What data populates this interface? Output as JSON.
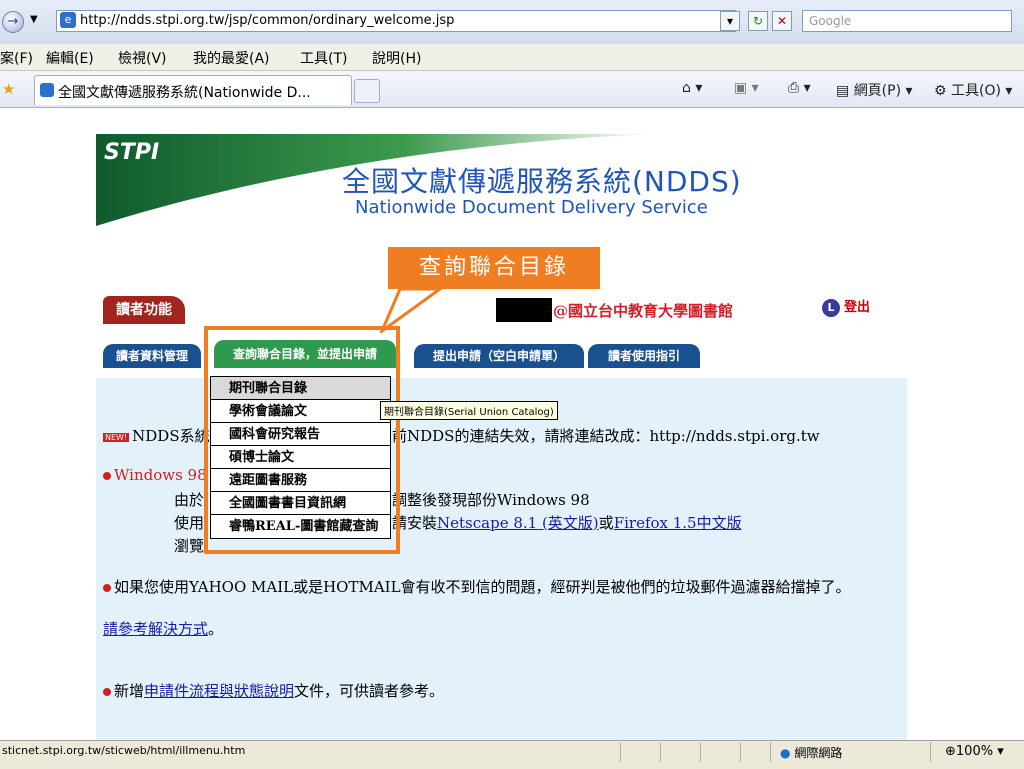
{
  "browser": {
    "url": "http://ndds.stpi.org.tw/jsp/common/ordinary_welcome.jsp",
    "search_placeholder": "Google",
    "menu": [
      "案(F)",
      "編輯(E)",
      "檢視(V)",
      "我的最愛(A)",
      "工具(T)",
      "說明(H)"
    ],
    "tab_title": "全國文獻傳遞服務系統(Nationwide D...",
    "toolbar_page": "網頁(P)",
    "toolbar_tools": "工具(O)"
  },
  "header": {
    "logo": "STPI",
    "title": "全國文獻傳遞服務系統(NDDS)",
    "subtitle": "Nationwide Document Delivery Service"
  },
  "callout": "查詢聯合目錄",
  "reader_badge": "讀者功能",
  "library": "@國立台中教育大學圖書館",
  "logout": "登出",
  "logout_icon_letter": "L",
  "nav_tabs": [
    "讀者資料管理",
    "查詢聯合目錄，並提出申請",
    "提出申請（空白申請單）",
    "讀者使用指引"
  ],
  "dropdown": [
    "期刊聯合目錄",
    "學術會議論文",
    "國科會研究報告",
    "碩博士論文",
    "遠距圖書服務",
    "全國圖書書目資訊網",
    "睿鴨REAL-圖書館藏查詢"
  ],
  "tooltip": "期刊聯合目錄(Serial Union Catalog)",
  "content": {
    "new_badge": "NEW!",
    "p1_pre": "NDDS系統",
    "p1_post": "前NDDS的連結失效，請將連結改成：http://ndds.stpi.org.tw",
    "p2_head": "Windows 98",
    "p2_l1_pre": "由於",
    "p2_l1_post": "調整後發現部份Windows 98",
    "p2_l2_pre": "使用",
    "p2_l2_mid": "請安裝",
    "p2_link1": "Netscape 8.1 (英文版)",
    "p2_or": "或",
    "p2_link2": "Firefox 1.5中文版",
    "p2_l3": "瀏覽",
    "p3": "如果您使用YAHOO MAIL或是HOTMAIL會有收不到信的問題，經研判是被他們的垃圾郵件過濾器給擋掉了。",
    "p3_link": "請參考解決方式",
    "p3_end": "。",
    "p4_pre": "新增",
    "p4_link": "申請件流程與狀態說明",
    "p4_post": "文件，可供讀者參考。"
  },
  "status": {
    "text": "sticnet.stpi.org.tw/sticweb/html/illmenu.htm",
    "zone": "網際網路",
    "zoom": "100%"
  }
}
